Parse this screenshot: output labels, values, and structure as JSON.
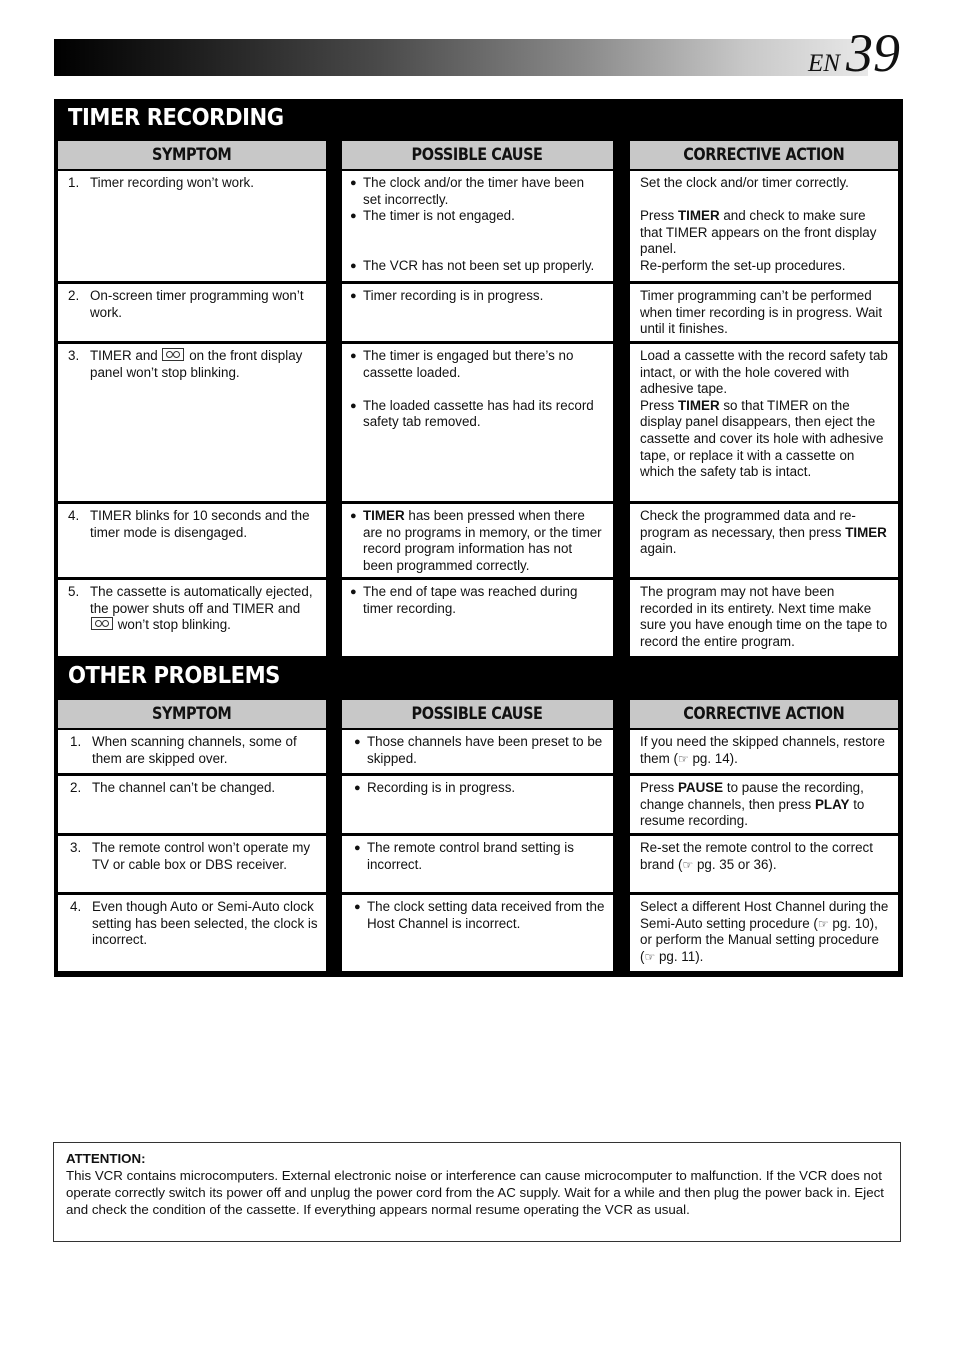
{
  "header": {
    "lang": "EN",
    "page_number": "39"
  },
  "columns": {
    "symptom": "SYMPTOM",
    "cause": "POSSIBLE CAUSE",
    "action": "CORRECTIVE ACTION"
  },
  "timer_recording": {
    "title": "TIMER RECORDING",
    "rows": [
      {
        "num": "1.",
        "symptom": "Timer recording won’t work.",
        "causes": [
          "The clock and/or the timer have been set incorrectly.",
          "The timer is not engaged.",
          "The VCR has not been set up properly."
        ],
        "actions": [
          "Set the clock and/or timer correctly.",
          "Press TIMER and check to make sure that TIMER appears on the front display panel.",
          "Re-perform the set-up procedures."
        ]
      },
      {
        "num": "2.",
        "symptom": "On-screen timer programming won’t work.",
        "causes": [
          "Timer recording is in progress."
        ],
        "actions": [
          "Timer programming can’t be performed when timer recording is in progress. Wait until it finishes."
        ]
      },
      {
        "num": "3.",
        "symptom_pre": "TIMER and",
        "symptom_post": "on the front display panel won’t stop blinking.",
        "causes": [
          "The timer is engaged but there’s no cassette loaded.",
          "The loaded cassette has had its record safety tab removed."
        ],
        "actions": [
          "Load a cassette with the record safety tab intact, or with the hole covered with adhesive tape.",
          "Press TIMER so that TIMER on the display panel disappears, then eject the cassette and cover its hole with adhesive tape, or replace it with a cassette on which the safety tab is intact."
        ]
      },
      {
        "num": "4.",
        "symptom": "TIMER blinks for 10 seconds and the timer mode is disengaged.",
        "causes": [
          "TIMER has been pressed when there are no programs in memory, or the timer record program information has not been programmed correctly."
        ],
        "actions": [
          "Check the programmed data and re-program as necessary, then press TIMER again."
        ]
      },
      {
        "num": "5.",
        "symptom_pre": "The cassette is automatically ejected, the power shuts off and TIMER and",
        "symptom_post": "won’t stop blinking.",
        "causes": [
          "The end of tape was reached during timer recording."
        ],
        "actions": [
          "The program may not have been recorded in its entirety. Next time make sure you have enough time on the tape to record the entire program."
        ]
      }
    ]
  },
  "other_problems": {
    "title": "OTHER PROBLEMS",
    "rows": [
      {
        "num": "1.",
        "symptom": "When scanning channels, some of them are skipped over.",
        "cause": "Those channels have been preset to be skipped.",
        "action_pre": "If you need the skipped channels, restore them (",
        "action_ref": "pg. 14)."
      },
      {
        "num": "2.",
        "symptom": "The channel can’t be changed.",
        "cause": "Recording is in progress.",
        "action": "Press PAUSE to pause the recording, change channels, then press PLAY to resume recording."
      },
      {
        "num": "3.",
        "symptom": "The remote control won’t operate my TV or cable box or DBS receiver.",
        "cause": "The remote control brand setting is incorrect.",
        "action_pre": "Re-set the remote control to the correct brand (",
        "action_ref": "pg. 35 or 36)."
      },
      {
        "num": "4.",
        "symptom": "Even though Auto or Semi-Auto clock setting has been selected, the clock is incorrect.",
        "cause": "The clock setting data received from the Host Channel is incorrect.",
        "action_a": "Select a different Host Channel during the Semi-Auto setting procedure (",
        "action_b": "pg. 10), or perform the Manual setting procedure (",
        "action_c": "pg. 11)."
      }
    ]
  },
  "bold_keys": {
    "timer": "TIMER",
    "pause": "PAUSE",
    "play": "PLAY"
  },
  "action_fragments": {
    "t1_press": "Press",
    "t1_rest": "and check to make sure that TIMER appears on the front display panel.",
    "t3_press": "Press",
    "t3_rest": "so that TIMER on the display panel disappears, then eject the cassette and cover its hole with adhesive tape, or replace it with a cassette on which the safety tab is intact.",
    "t4_pre": "Check the programmed data and re-program as necessary, then press",
    "t4_post": "again.",
    "c4_post": "has been pressed when there are no programs in memory, or the timer record program information has not been programmed correctly.",
    "o2_a": "Press",
    "o2_b": "to pause the recording, change channels, then press",
    "o2_c": "to resume recording."
  },
  "icons": {
    "bullet": "●",
    "hand": "☞"
  },
  "attention": {
    "title": "ATTENTION:",
    "body": "This VCR contains microcomputers. External electronic noise or interference can cause microcomputer to malfunction. If the VCR does not operate correctly switch its power off and unplug the power cord from the AC supply. Wait for a while and then plug the power back in. Eject and check the condition of the cassette. If everything appears normal resume operating the VCR as usual."
  }
}
